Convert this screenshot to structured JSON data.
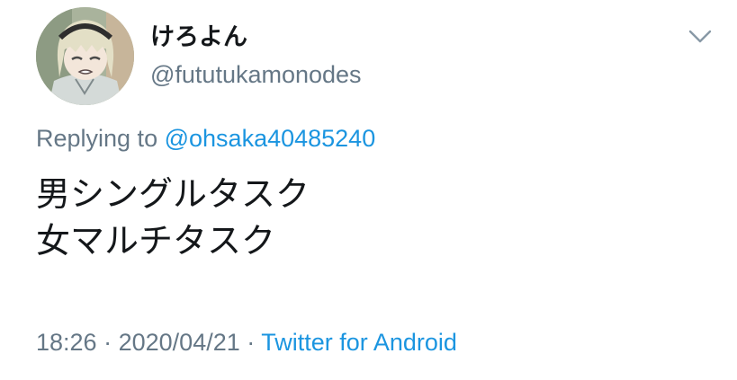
{
  "tweet": {
    "author": {
      "display_name": "けろよん",
      "handle": "@fututukamonodes"
    },
    "menu_icon": "chevron-down-icon",
    "replying": {
      "prefix": "Replying to",
      "mention": "@ohsaka40485240"
    },
    "lines": [
      "男シングルタスク",
      "女マルチタスク"
    ],
    "meta": {
      "time": "18:26",
      "sep1": "·",
      "date": "2020/04/21",
      "sep2": "·",
      "source": "Twitter for Android"
    },
    "colors": {
      "text": "#14171a",
      "secondary": "#657786",
      "link": "#1b95e0"
    }
  }
}
